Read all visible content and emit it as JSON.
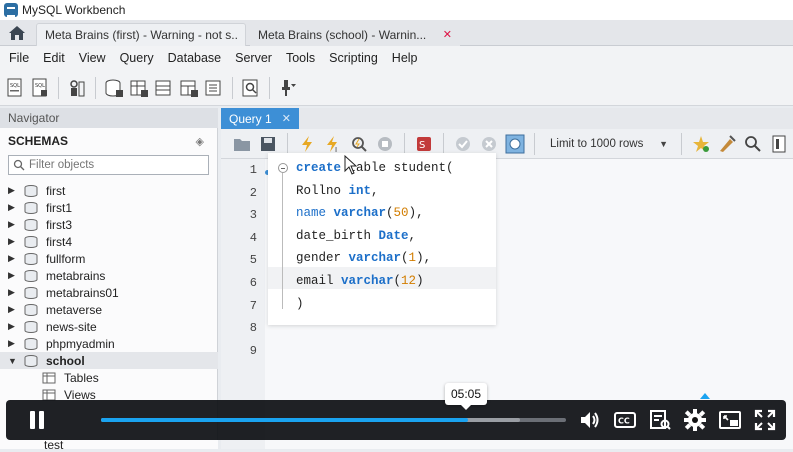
{
  "window": {
    "title": "MySQL Workbench"
  },
  "connection_tabs": [
    {
      "label": "Meta Brains (first) - Warning - not s..."
    },
    {
      "label": "Meta Brains (school) - Warnin..."
    }
  ],
  "menu": [
    "File",
    "Edit",
    "View",
    "Query",
    "Database",
    "Server",
    "Tools",
    "Scripting",
    "Help"
  ],
  "navigator": {
    "header": "Navigator",
    "schemas_label": "SCHEMAS",
    "filter_placeholder": "Filter objects",
    "schemas": [
      "first",
      "first1",
      "first3",
      "first4",
      "fullform",
      "metabrains",
      "metabrains01",
      "metaverse",
      "news-site",
      "phpmyadmin",
      "school"
    ],
    "selected_schema": "school",
    "school_children": [
      "Tables",
      "Views"
    ],
    "partially_hidden": "test"
  },
  "editor": {
    "tab_label": "Query 1",
    "limit_label": "Limit to 1000 rows",
    "line_numbers": [
      "1",
      "2",
      "3",
      "4",
      "5",
      "6",
      "7",
      "8",
      "9"
    ],
    "code": [
      {
        "parts": [
          {
            "t": "create",
            "c": "kw"
          },
          {
            "t": " table student(",
            "c": ""
          }
        ]
      },
      {
        "parts": [
          {
            "t": "Rollno ",
            "c": ""
          },
          {
            "t": "int",
            "c": "kw"
          },
          {
            "t": ",",
            "c": ""
          }
        ]
      },
      {
        "parts": [
          {
            "t": "name ",
            "c": "kw-plain"
          },
          {
            "t": "varchar",
            "c": "kw"
          },
          {
            "t": "(",
            "c": ""
          },
          {
            "t": "50",
            "c": "num"
          },
          {
            "t": "),",
            "c": ""
          }
        ]
      },
      {
        "parts": [
          {
            "t": "date_birth ",
            "c": ""
          },
          {
            "t": "Date",
            "c": "kw"
          },
          {
            "t": ",",
            "c": ""
          }
        ]
      },
      {
        "parts": [
          {
            "t": "gender ",
            "c": ""
          },
          {
            "t": "varchar",
            "c": "kw"
          },
          {
            "t": "(",
            "c": ""
          },
          {
            "t": "1",
            "c": "num"
          },
          {
            "t": "),",
            "c": ""
          }
        ]
      },
      {
        "parts": [
          {
            "t": "email ",
            "c": ""
          },
          {
            "t": "varchar",
            "c": "kw"
          },
          {
            "t": "(",
            "c": ""
          },
          {
            "t": "12",
            "c": "num"
          },
          {
            "t": ")",
            "c": ""
          }
        ]
      },
      {
        "parts": [
          {
            "t": ")",
            "c": ""
          }
        ]
      }
    ]
  },
  "video": {
    "current_time_label": "05:05",
    "progress": 0.79,
    "buffered": 0.9
  },
  "colors": {
    "accent": "#3d8fd6",
    "progress": "#1aa3f0",
    "keyword": "#1c6fc9",
    "number": "#d27d00"
  }
}
